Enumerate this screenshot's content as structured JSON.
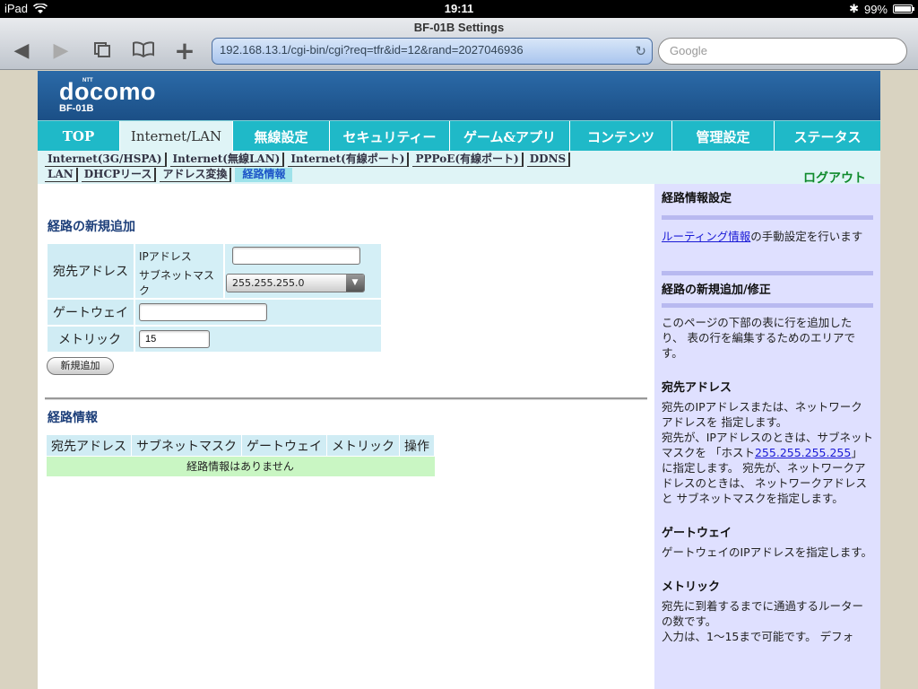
{
  "status_bar": {
    "device": "iPad",
    "time": "19:11",
    "bluetooth": "✱",
    "battery": "99%",
    "battery_level": 0.99
  },
  "browser": {
    "page_title": "BF-01B Settings",
    "url": "192.168.13.1/cgi-bin/cgi?req=tfr&id=12&rand=2027046936",
    "search_placeholder": "Google"
  },
  "header": {
    "logo_small": "NTT",
    "logo": "docomo",
    "model": "BF-01B"
  },
  "main_tabs": [
    {
      "label": "TOP"
    },
    {
      "label": "Internet/LAN"
    },
    {
      "label": "無線設定"
    },
    {
      "label": "セキュリティー"
    },
    {
      "label": "ゲーム&アプリ"
    },
    {
      "label": "コンテンツ"
    },
    {
      "label": "管理設定"
    },
    {
      "label": "ステータス"
    }
  ],
  "sub_nav": {
    "row1": [
      "Internet(3G/HSPA)",
      "Internet(無線LAN)",
      "Internet(有線ポート)",
      "PPPoE(有線ポート)",
      "DDNS"
    ],
    "row2": [
      "LAN",
      "DHCPリース",
      "アドレス変換",
      "経路情報"
    ],
    "logout": "ログアウト"
  },
  "form": {
    "title": "経路の新規追加",
    "destination_label": "宛先アドレス",
    "ip_label": "IPアドレス",
    "ip_value": "",
    "subnet_label": "サブネットマスク",
    "subnet_value": "255.255.255.0",
    "gateway_label": "ゲートウェイ",
    "gateway_value": "",
    "metric_label": "メトリック",
    "metric_value": "15",
    "add_button": "新規追加"
  },
  "routes": {
    "title": "経路情報",
    "columns": [
      "宛先アドレス",
      "サブネットマスク",
      "ゲートウェイ",
      "メトリック",
      "操作"
    ],
    "empty_message": "経路情報はありません"
  },
  "sidebar": {
    "s1_title": "経路情報設定",
    "s1_link": "ルーティング情報",
    "s1_text": "の手動設定を行います",
    "s2_title": "経路の新規追加/修正",
    "s2_text": "このページの下部の表に行を追加したり、 表の行を編集するためのエリアです。",
    "s3_title": "宛先アドレス",
    "s3_text1": "宛先のIPアドレスまたは、ネットワークアドレスを 指定します。",
    "s3_text2a": "宛先が、IPアドレスのときは、サブネットマスクを 「ホスト",
    "s3_link": "255.255.255.255",
    "s3_text2b": "」に指定します。 宛先が、ネットワークアドレスのときは、 ネットワークアドレスと サブネットマスクを指定します。",
    "s4_title": "ゲートウェイ",
    "s4_text": "ゲートウェイのIPアドレスを指定します。",
    "s5_title": "メトリック",
    "s5_text1": "宛先に到着するまでに通過するルーターの数です。",
    "s5_text2": "入力は、1〜15まで可能です。 デフォ"
  },
  "colors": {
    "header_blue": "#2b6aa8",
    "tab_cyan": "#1fb9c8",
    "sidebar_bg": "#dfe0ff",
    "logout_green": "#0f8a2c",
    "empty_row_green": "#c9f6c3"
  }
}
